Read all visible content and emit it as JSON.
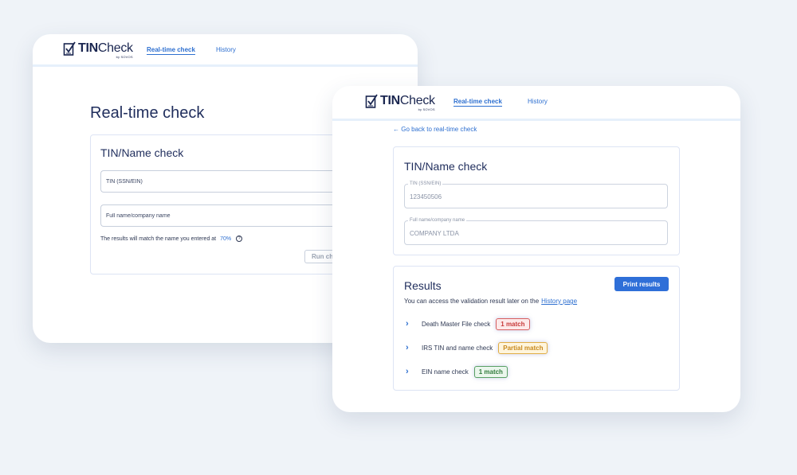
{
  "colors": {
    "accent": "#2d6fd0",
    "button": "#2f6fd8",
    "background": "#eff3f8",
    "title": "#1f2d5c"
  },
  "back_window": {
    "logo": {
      "tin": "TIN",
      "check": "Check",
      "by": "by SOVOS",
      "icon": "checklist-logo-icon"
    },
    "nav": {
      "realtime": "Real-time check",
      "history": "History"
    },
    "page_title": "Real-time check",
    "form": {
      "title": "TIN/Name check",
      "tin_placeholder": "TIN (SSN/EIN)",
      "name_placeholder": "Full name/company name",
      "match_text": "The results will match the name you entered at",
      "match_percent": "70%",
      "help_icon": "question-circle-icon",
      "run_button": "Run ch"
    }
  },
  "front_window": {
    "logo": {
      "tin": "TIN",
      "check": "Check",
      "by": "by SOVOS",
      "icon": "checklist-logo-icon"
    },
    "nav": {
      "realtime": "Real-time check",
      "history": "History"
    },
    "back_link": "← Go back to real-time check",
    "form": {
      "title": "TIN/Name check",
      "tin_label": "TIN (SSN/EIN)",
      "tin_value": "123450506",
      "name_label": "Full name/company name",
      "name_value": "COMPANY LTDA"
    },
    "results": {
      "title": "Results",
      "print_button": "Print results",
      "note_prefix": "You can access the validation result later on the",
      "history_link": "History page",
      "rows": [
        {
          "label": "Death Master File check",
          "badge": "1 match",
          "status": "red"
        },
        {
          "label": "IRS TIN and name check",
          "badge": "Partial match",
          "status": "yellow"
        },
        {
          "label": "EIN name check",
          "badge": "1 match",
          "status": "green"
        }
      ],
      "expand_icon": "chevron-right-icon"
    }
  }
}
